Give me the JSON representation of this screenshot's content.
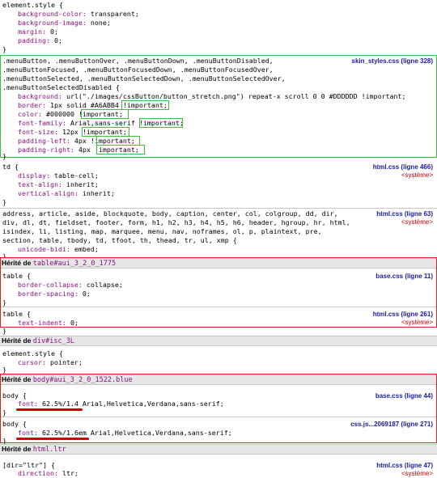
{
  "rules": {
    "r1": {
      "sel": "element.style {",
      "p1": "background-color:",
      "v1": " transparent;",
      "p2": "background-image:",
      "v2": " none;",
      "p3": "margin:",
      "v3": " 0;",
      "p4": "padding:",
      "v4": " 0;",
      "close": "}"
    },
    "r2": {
      "sel1": ".menuButton, .menuButtonOver, .menuButtonDown, .menuButtonDisabled,",
      "sel2": ".menuButtonFocused, .menuButtonFocusedDown, .menuButtonFocusedOver,",
      "sel3": ".menuButtonSelected, .menuButtonSelectedDown, .menuButtonSelectedOver,",
      "sel4": ".menuButtonSelectedDisabled {",
      "p1": "background:",
      "v1": " url(\"./images/cssButton/button_stretch.png\") repeat-x scroll 0 0 #DDDDDD !important;",
      "p2": "border:",
      "v2": " 1px solid #A6ABB4 ",
      "i2": "!important;",
      "p3": "color:",
      "v3": " #000000 ",
      "i3": "!important;",
      "p4": "font-family:",
      "v4": " Arial,sans-serif ",
      "i4": "!important;",
      "p5": "font-size:",
      "v5": " 12px ",
      "i5": "!important;",
      "p6": "padding-left:",
      "v6": " 4px ",
      "i6": "!important;",
      "p7": "padding-right:",
      "v7": " 4px ",
      "i7": "!important;",
      "close": "}",
      "src": "skin_styles.css (ligne 328)"
    },
    "r3": {
      "sel": "td {",
      "p1": "display:",
      "v1": " table-cell;",
      "p2": "text-align:",
      "v2": " inherit;",
      "p3": "vertical-align:",
      "v3": " inherit;",
      "close": "}",
      "src": "html.css (ligne 466)",
      "sys": "<système>"
    },
    "r4": {
      "sel1": "address, article, aside, blockquote, body, caption, center, col, colgroup, dd, dir,",
      "sel2": "div, dl, dt, fieldset, footer, form, h1, h2, h3, h4, h5, h6, header, hgroup, hr, html,",
      "sel3": "isindex, li, listing, map, marquee, menu, nav, noframes, ol, p, plaintext, pre,",
      "sel4": "section, table, tbody, td, tfoot, th, thead, tr, ul, xmp {",
      "p1": "unicode-bidi:",
      "v1": " embed;",
      "close": "}",
      "src": "html.css (ligne 63)",
      "sys": "<système>"
    },
    "inh1": {
      "label": "Hérité de ",
      "name": "table#aui_3_2_0_1775"
    },
    "r5": {
      "sel": "table {",
      "p1": "border-collapse:",
      "v1": " collapse;",
      "p2": "border-spacing:",
      "v2": " 0;",
      "close": "}",
      "src": "base.css (ligne 11)"
    },
    "r6": {
      "sel": "table {",
      "p1": "text-indent:",
      "v1": " 0;",
      "close": "}",
      "src": "html.css (ligne 261)",
      "sys": "<système>"
    },
    "inh2": {
      "label": "Hérité de ",
      "name": "div#isc_3L"
    },
    "r7": {
      "sel": "element.style {",
      "p1": "cursor:",
      "v1": " pointer;",
      "close": "}"
    },
    "inh3": {
      "label": "Hérité de ",
      "name": "body#aui_3_2_0_1522.blue"
    },
    "r8": {
      "sel": "body {",
      "p1": "font:",
      "v1": " 62.5%/1.4 Arial,Helvetica,Verdana,sans-serif;",
      "close": "}",
      "src": "base.css (ligne 44)"
    },
    "r9": {
      "sel": "body {",
      "p1": "font:",
      "v1": " 62.5%/1.6em Arial,Helvetica,Verdana,sans-serif;",
      "close": "}",
      "src": "css.js...2069187 (ligne 271)"
    },
    "inh4": {
      "label": "Hérité de ",
      "name": "html.ltr"
    },
    "r10": {
      "sel": "[dir=\"ltr\"] {",
      "p1": "direction:",
      "v1": " ltr;",
      "src": "html.css (ligne 47)",
      "sys": "<système>"
    }
  },
  "colors": {
    "property": "#881280",
    "source_link": "#1a1aa6",
    "system": "#c80000",
    "highlight_green": "#3ac23a",
    "highlight_red": "#d22",
    "underline": "#c00"
  }
}
